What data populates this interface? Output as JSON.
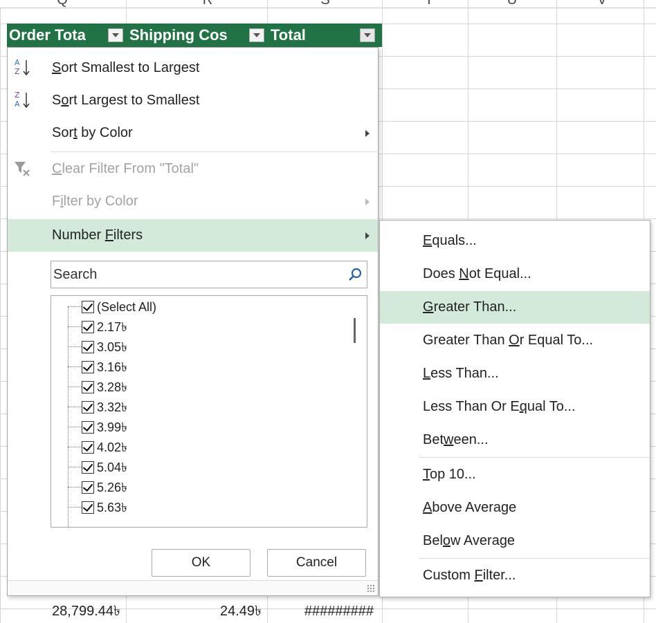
{
  "columns": [
    "Q",
    "R",
    "S",
    "T",
    "U",
    "V"
  ],
  "header": {
    "cells": [
      "Order Tota",
      "Shipping Cos",
      "Total"
    ]
  },
  "menu": {
    "sort_asc": {
      "before": "",
      "accel": "S",
      "after": "ort Smallest to Largest"
    },
    "sort_desc": {
      "before": "S",
      "accel": "o",
      "after": "rt Largest to Smallest"
    },
    "sort_color": {
      "before": "Sor",
      "accel": "t",
      "after": " by Color"
    },
    "clear_filter": {
      "before": "",
      "accel": "C",
      "after": "lear Filter From \"Total\""
    },
    "filter_color": {
      "before": "F",
      "accel": "i",
      "after": "lter by Color"
    },
    "number_filters": {
      "before": "Number ",
      "accel": "F",
      "after": "ilters"
    }
  },
  "search": {
    "placeholder": "Search"
  },
  "list": {
    "items": [
      "(Select All)",
      "2.17৳",
      "3.05৳",
      "3.16৳",
      "3.28৳",
      "3.32৳",
      "3.99৳",
      "4.02৳",
      "5.04৳",
      "5.26৳",
      "5.63৳"
    ]
  },
  "buttons": {
    "ok": "OK",
    "cancel": "Cancel"
  },
  "submenu": {
    "equals": {
      "before": "",
      "accel": "E",
      "after": "quals..."
    },
    "not_equal": {
      "before": "Does ",
      "accel": "N",
      "after": "ot Equal..."
    },
    "greater": {
      "before": "",
      "accel": "G",
      "after": "reater Than..."
    },
    "greater_eq": {
      "before": "Greater Than ",
      "accel": "O",
      "after": "r Equal To..."
    },
    "less": {
      "before": "",
      "accel": "L",
      "after": "ess Than..."
    },
    "less_eq": {
      "before": "Less Than Or E",
      "accel": "q",
      "after": "ual To..."
    },
    "between": {
      "before": "Bet",
      "accel": "w",
      "after": "een..."
    },
    "top10": {
      "before": "",
      "accel": "T",
      "after": "op 10..."
    },
    "above_avg": {
      "before": "",
      "accel": "A",
      "after": "bove Average"
    },
    "below_avg": {
      "before": "Bel",
      "accel": "o",
      "after": "w Average"
    },
    "custom": {
      "before": "Custom ",
      "accel": "F",
      "after": "ilter..."
    }
  },
  "bottom_row": [
    "28,799.44৳",
    "24.49৳",
    "#########"
  ],
  "colors": {
    "header_green": "#217346",
    "highlight": "#d3eadb"
  }
}
